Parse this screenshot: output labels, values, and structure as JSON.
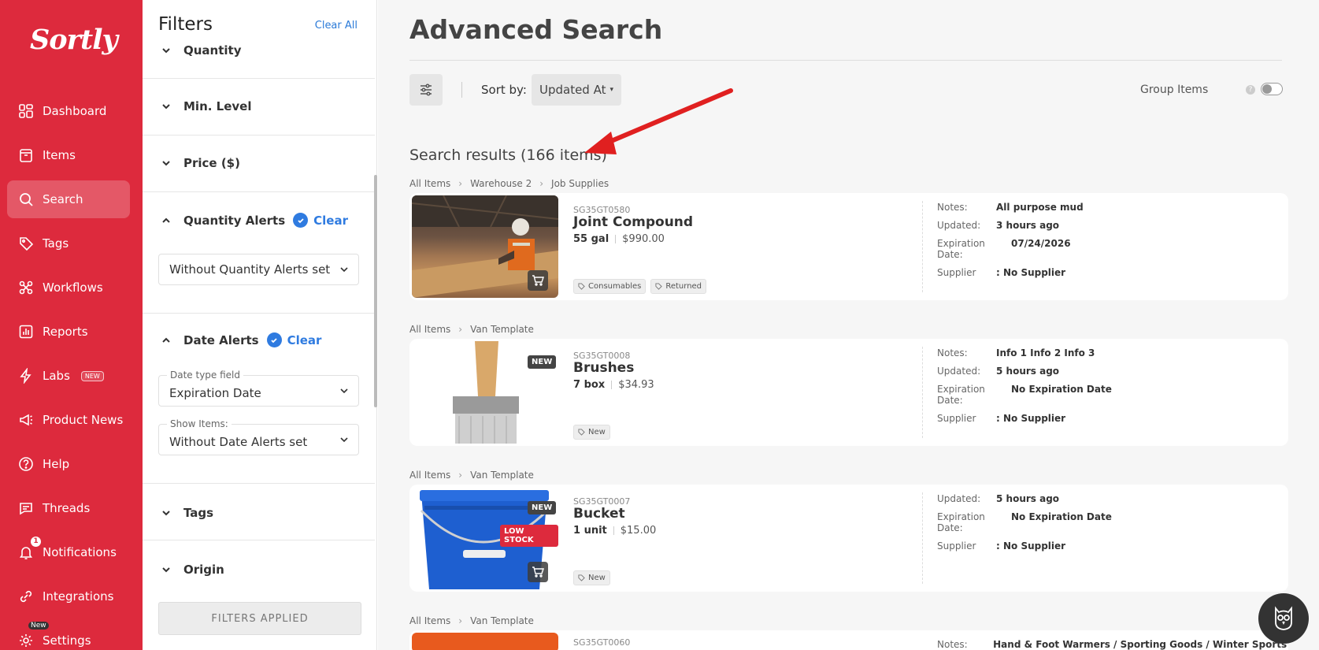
{
  "app": {
    "logo": "Sortly"
  },
  "sidebar": {
    "items": [
      {
        "label": "Dashboard",
        "icon": "dashboard-icon"
      },
      {
        "label": "Items",
        "icon": "items-icon"
      },
      {
        "label": "Search",
        "icon": "search-icon",
        "active": true
      },
      {
        "label": "Tags",
        "icon": "tag-icon"
      },
      {
        "label": "Workflows",
        "icon": "workflows-icon"
      },
      {
        "label": "Reports",
        "icon": "reports-icon"
      },
      {
        "label": "Labs",
        "icon": "labs-icon",
        "badge": "NEW"
      },
      {
        "label": "Product News",
        "icon": "megaphone-icon"
      },
      {
        "label": "Help",
        "icon": "help-icon"
      },
      {
        "label": "Threads",
        "icon": "threads-icon"
      },
      {
        "label": "Notifications",
        "icon": "bell-icon",
        "count": "1"
      },
      {
        "label": "Integrations",
        "icon": "integrations-icon"
      },
      {
        "label": "Settings",
        "icon": "gear-icon",
        "badge": "New"
      }
    ]
  },
  "filters": {
    "title": "Filters",
    "clear_all": "Clear All",
    "sections": {
      "quantity": "Quantity",
      "min_level": "Min. Level",
      "price": "Price ($)",
      "quantity_alerts": "Quantity Alerts",
      "quantity_alerts_clear": "Clear",
      "quantity_alerts_value": "Without Quantity Alerts set",
      "date_alerts": "Date Alerts",
      "date_alerts_clear": "Clear",
      "date_type_label": "Date type field",
      "date_type_value": "Expiration Date",
      "show_items_label": "Show Items:",
      "show_items_value": "Without Date Alerts set",
      "tags": "Tags",
      "origin": "Origin"
    },
    "applied_button": "FILTERS APPLIED"
  },
  "main": {
    "title": "Advanced Search",
    "sort_label": "Sort by:",
    "sort_value": "Updated At",
    "group_items": "Group Items",
    "group_help": "?",
    "results_title": "Search results (166 items)",
    "cards": [
      {
        "crumbs": [
          "All Items",
          "Warehouse 2",
          "Job Supplies"
        ],
        "sku": "SG35GT0580",
        "name": "Joint Compound",
        "qty": "55 gal",
        "price": "$990.00",
        "tags": [
          "Consumables",
          "Returned"
        ],
        "meta": [
          {
            "k": "Notes:",
            "v": "All purpose mud"
          },
          {
            "k": "Updated:",
            "v": "3 hours ago"
          },
          {
            "k": "Expiration Date:",
            "v": "07/24/2026"
          },
          {
            "k": "Supplier",
            "v": ": No Supplier"
          }
        ]
      },
      {
        "crumbs": [
          "All Items",
          "Van Template"
        ],
        "sku": "SG35GT0008",
        "name": "Brushes",
        "qty": "7 box",
        "price": "$34.93",
        "badge": "NEW",
        "tags": [
          "New"
        ],
        "meta": [
          {
            "k": "Notes:",
            "v": "Info 1 Info 2 Info 3"
          },
          {
            "k": "Updated:",
            "v": "5 hours ago"
          },
          {
            "k": "Expiration Date:",
            "v": "No Expiration Date"
          },
          {
            "k": "Supplier",
            "v": ": No Supplier"
          }
        ]
      },
      {
        "crumbs": [
          "All Items",
          "Van Template"
        ],
        "sku": "SG35GT0007",
        "name": "Bucket",
        "qty": "1 unit",
        "price": "$15.00",
        "badge": "NEW",
        "badge2": "LOW STOCK",
        "tags": [
          "New"
        ],
        "meta": [
          {
            "k": "Updated:",
            "v": "5 hours ago"
          },
          {
            "k": "Expiration Date:",
            "v": "No Expiration Date"
          },
          {
            "k": "Supplier",
            "v": ": No Supplier"
          }
        ]
      },
      {
        "crumbs": [
          "All Items",
          "Van Template"
        ],
        "sku": "SG35GT0060",
        "notes_k": "Notes:",
        "notes_v": "Hand & Foot Warmers / Sporting Goods / Winter Sports /..."
      }
    ]
  },
  "colors": {
    "brand": "#dd2a3d",
    "link": "#2a7ad8",
    "annotation": "#e02020"
  }
}
